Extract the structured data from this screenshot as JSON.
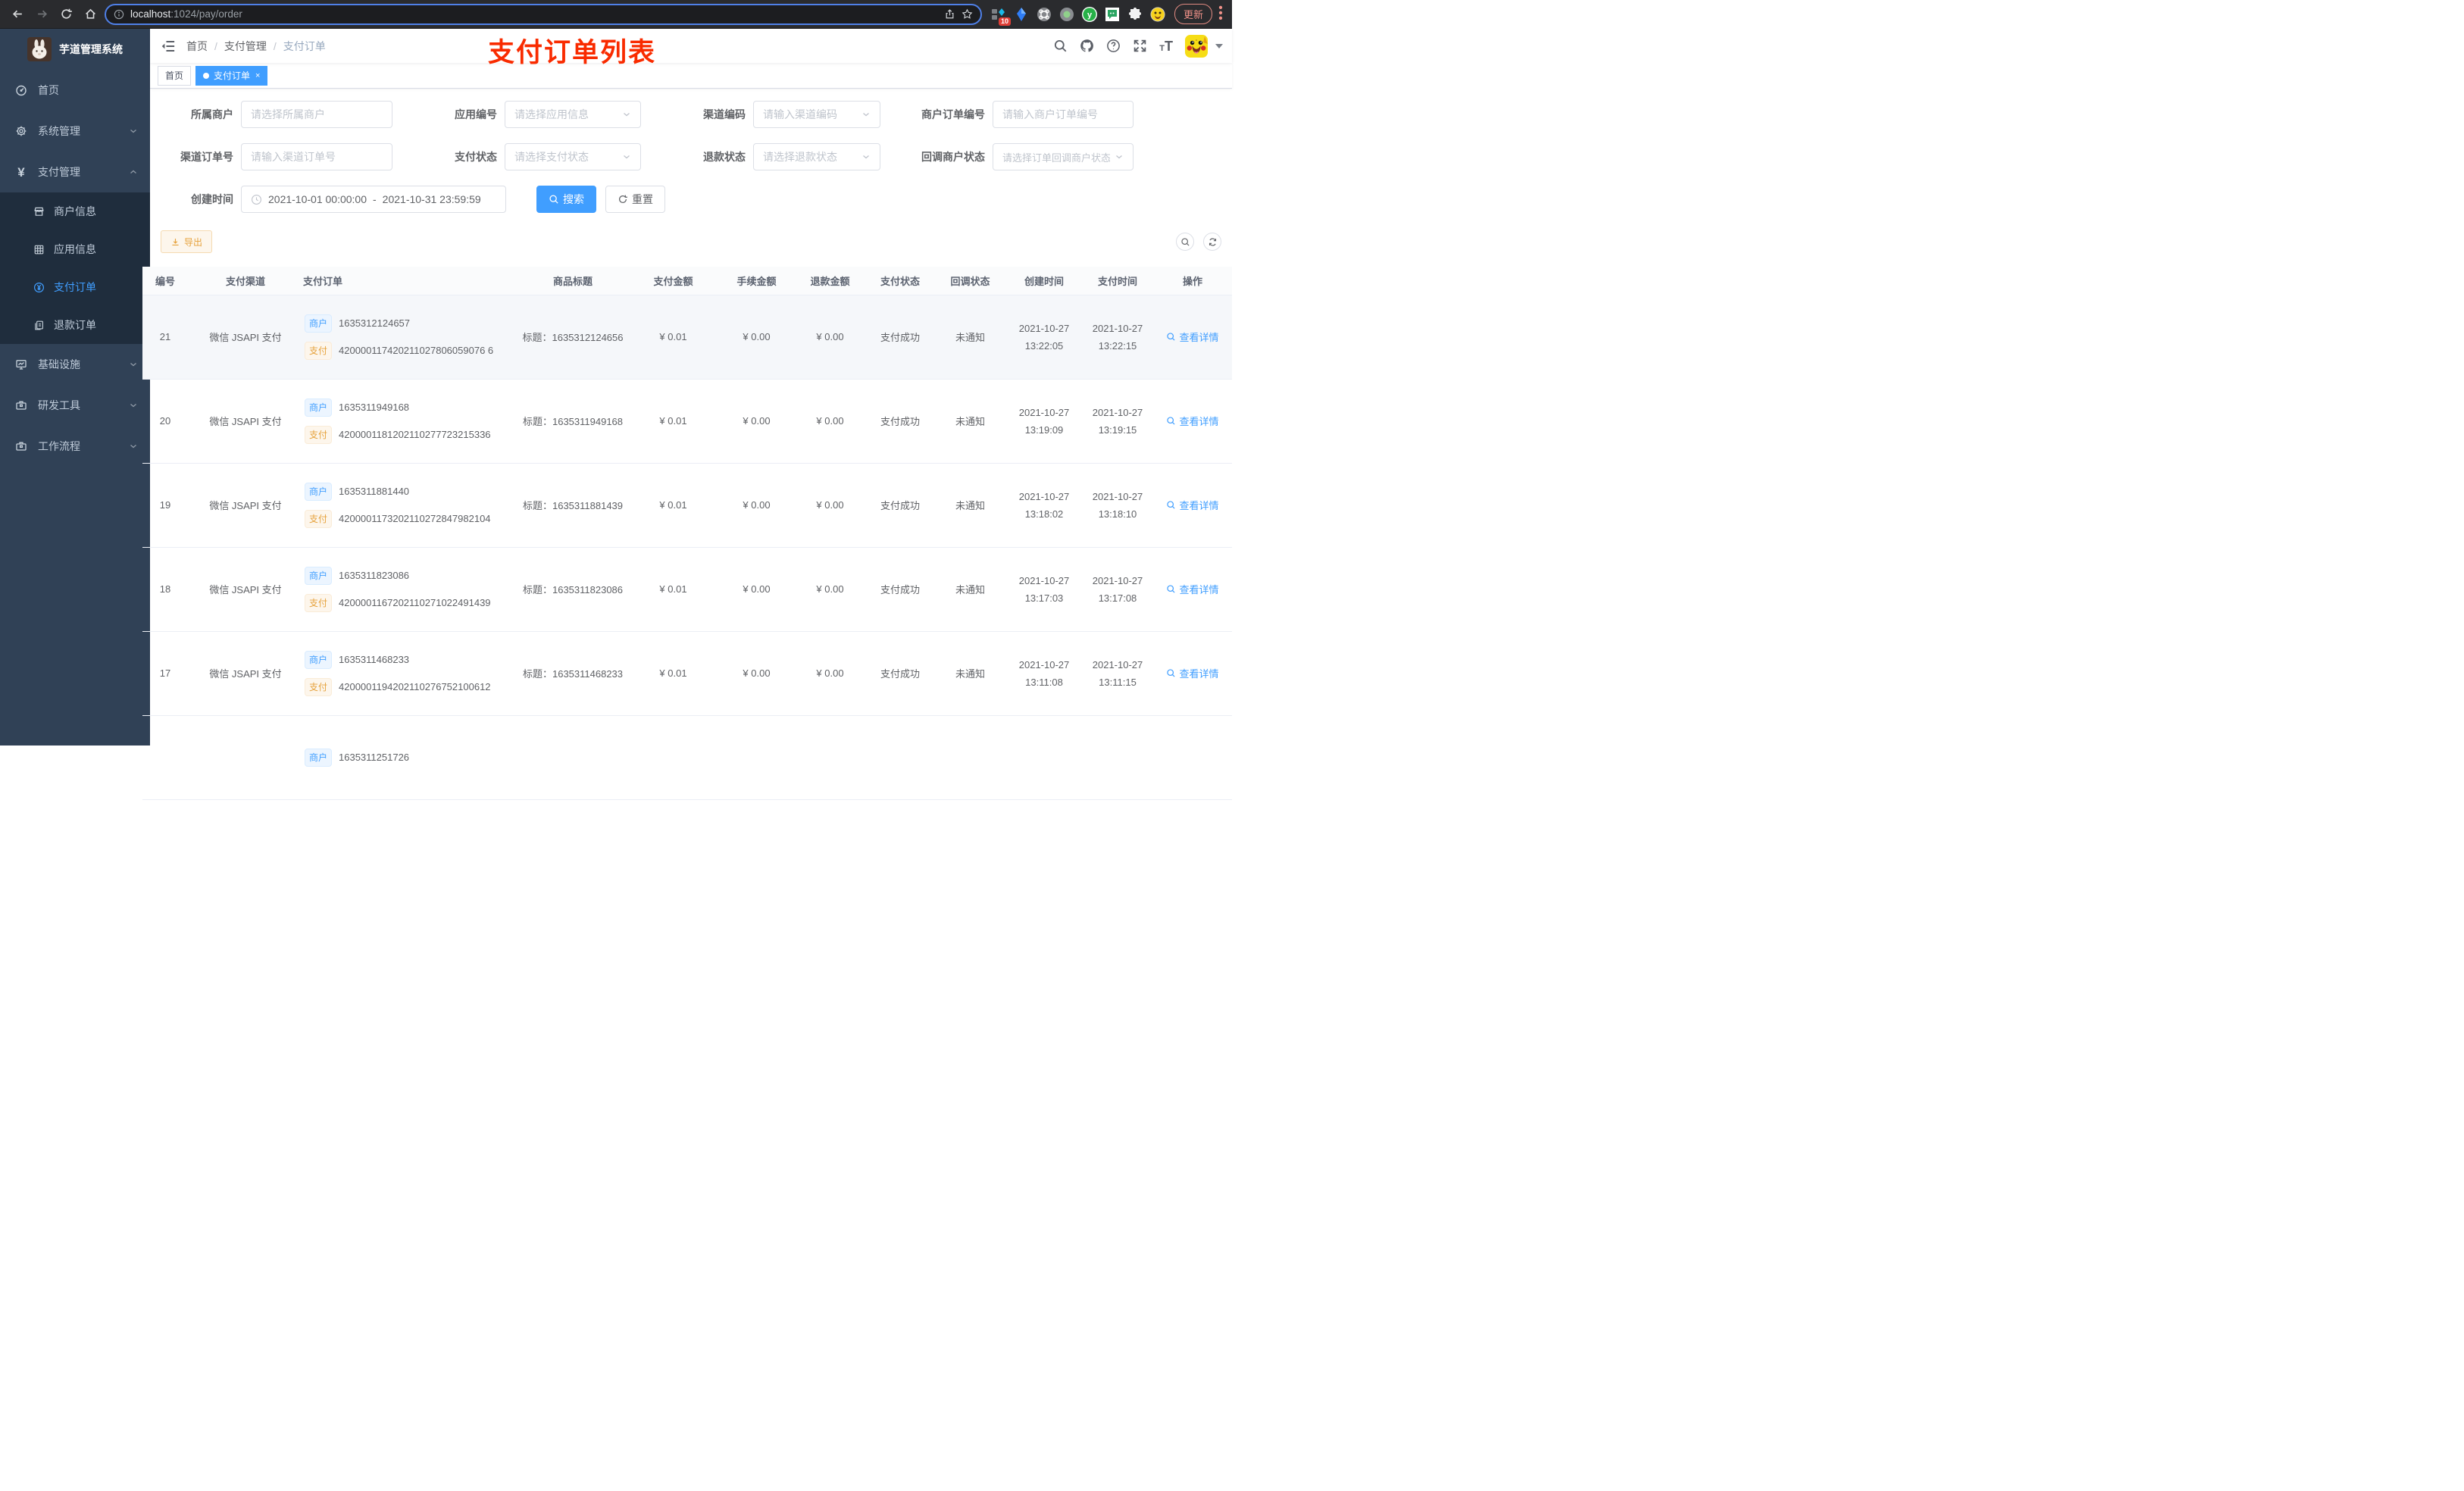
{
  "browser": {
    "url_host": "localhost",
    "url_path": ":1024/pay/order",
    "extension_badge": "10",
    "update_label": "更新"
  },
  "sidebar": {
    "title": "芋道管理系统",
    "items": {
      "home": "首页",
      "system": "系统管理",
      "payment": "支付管理",
      "merchant_info": "商户信息",
      "app_info": "应用信息",
      "pay_order": "支付订单",
      "refund_order": "退款订单",
      "infra": "基础设施",
      "devtools": "研发工具",
      "workflow": "工作流程"
    }
  },
  "header": {
    "breadcrumb": {
      "home": "首页",
      "parent": "支付管理",
      "current": "支付订单"
    },
    "annotation": "支付订单列表"
  },
  "tags": {
    "home": "首页",
    "current": "支付订单",
    "close": "×"
  },
  "filters": {
    "merchant": {
      "label": "所属商户",
      "placeholder": "请选择所属商户"
    },
    "app": {
      "label": "应用编号",
      "placeholder": "请选择应用信息"
    },
    "channel_code": {
      "label": "渠道编码",
      "placeholder": "请输入渠道编码"
    },
    "merchant_order_no": {
      "label": "商户订单编号",
      "placeholder": "请输入商户订单编号"
    },
    "channel_order_no": {
      "label": "渠道订单号",
      "placeholder": "请输入渠道订单号"
    },
    "pay_status": {
      "label": "支付状态",
      "placeholder": "请选择支付状态"
    },
    "refund_status": {
      "label": "退款状态",
      "placeholder": "请选择退款状态"
    },
    "notify_status": {
      "label": "回调商户状态",
      "placeholder": "请选择订单回调商户状态"
    },
    "create_time": {
      "label": "创建时间",
      "start": "2021-10-01 00:00:00",
      "separator": "-",
      "end": "2021-10-31 23:59:59"
    },
    "search_label": "搜索",
    "reset_label": "重置"
  },
  "toolbar": {
    "export_label": "导出"
  },
  "table": {
    "columns": {
      "no": "编号",
      "channel": "支付渠道",
      "order": "支付订单",
      "title": "商品标题",
      "amount": "支付金额",
      "fee": "手续金额",
      "refund": "退款金额",
      "pay_status": "支付状态",
      "notify_status": "回调状态",
      "create_time": "创建时间",
      "pay_time": "支付时间",
      "action": "操作"
    },
    "labels": {
      "merchant_tag": "商户",
      "pay_tag": "支付",
      "view_detail": "查看详情"
    },
    "rows": [
      {
        "no": "21",
        "channel": "微信 JSAPI 支付",
        "merchant_no": "1635312124657",
        "pay_no": "420000117420211027806059076 6",
        "title": "标题：1635312124656",
        "amount": "¥ 0.01",
        "fee": "¥ 0.00",
        "refund": "¥ 0.00",
        "pay_status": "支付成功",
        "notify_status": "未通知",
        "create_date": "2021-10-27",
        "create_time": "13:22:05",
        "pay_date": "2021-10-27",
        "pay_time": "13:22:15"
      },
      {
        "no": "20",
        "channel": "微信 JSAPI 支付",
        "merchant_no": "1635311949168",
        "pay_no": "4200001181202110277723215336",
        "title": "标题：1635311949168",
        "amount": "¥ 0.01",
        "fee": "¥ 0.00",
        "refund": "¥ 0.00",
        "pay_status": "支付成功",
        "notify_status": "未通知",
        "create_date": "2021-10-27",
        "create_time": "13:19:09",
        "pay_date": "2021-10-27",
        "pay_time": "13:19:15"
      },
      {
        "no": "19",
        "channel": "微信 JSAPI 支付",
        "merchant_no": "1635311881440",
        "pay_no": "4200001173202110272847982104",
        "title": "标题：1635311881439",
        "amount": "¥ 0.01",
        "fee": "¥ 0.00",
        "refund": "¥ 0.00",
        "pay_status": "支付成功",
        "notify_status": "未通知",
        "create_date": "2021-10-27",
        "create_time": "13:18:02",
        "pay_date": "2021-10-27",
        "pay_time": "13:18:10"
      },
      {
        "no": "18",
        "channel": "微信 JSAPI 支付",
        "merchant_no": "1635311823086",
        "pay_no": "4200001167202110271022491439",
        "title": "标题：1635311823086",
        "amount": "¥ 0.01",
        "fee": "¥ 0.00",
        "refund": "¥ 0.00",
        "pay_status": "支付成功",
        "notify_status": "未通知",
        "create_date": "2021-10-27",
        "create_time": "13:17:03",
        "pay_date": "2021-10-27",
        "pay_time": "13:17:08"
      },
      {
        "no": "17",
        "channel": "微信 JSAPI 支付",
        "merchant_no": "1635311468233",
        "pay_no": "4200001194202110276752100612",
        "title": "标题：1635311468233",
        "amount": "¥ 0.01",
        "fee": "¥ 0.00",
        "refund": "¥ 0.00",
        "pay_status": "支付成功",
        "notify_status": "未通知",
        "create_date": "2021-10-27",
        "create_time": "13:11:08",
        "pay_date": "2021-10-27",
        "pay_time": "13:11:15"
      },
      {
        "no": "",
        "channel": "",
        "merchant_no": "1635311251726",
        "pay_no": "",
        "title": "",
        "amount": "",
        "fee": "",
        "refund": "",
        "pay_status": "",
        "notify_status": "",
        "create_date": "",
        "create_time": "",
        "pay_date": "",
        "pay_time": ""
      }
    ]
  }
}
